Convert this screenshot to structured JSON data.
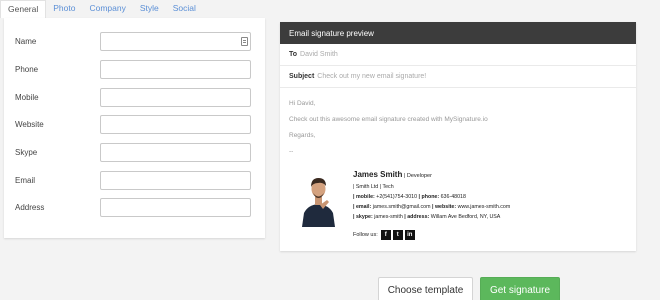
{
  "tabs": [
    {
      "label": "General",
      "active": true
    },
    {
      "label": "Photo",
      "active": false
    },
    {
      "label": "Company",
      "active": false
    },
    {
      "label": "Style",
      "active": false
    },
    {
      "label": "Social",
      "active": false
    }
  ],
  "form": {
    "fields": [
      {
        "label": "Name",
        "value": ""
      },
      {
        "label": "Phone",
        "value": ""
      },
      {
        "label": "Mobile",
        "value": ""
      },
      {
        "label": "Website",
        "value": ""
      },
      {
        "label": "Skype",
        "value": ""
      },
      {
        "label": "Email",
        "value": ""
      },
      {
        "label": "Address",
        "value": ""
      }
    ]
  },
  "preview": {
    "header": "Email signature preview",
    "to_label": "To",
    "to_value": "David Smith",
    "subject_label": "Subject",
    "subject_value": "Check out my new email signature!",
    "greeting": "Hi David,",
    "body": "Check out this awesome email signature created with MySignature.io",
    "closing": "Regards,",
    "separator": "--"
  },
  "signature": {
    "name": "James Smith",
    "title": " | Developer",
    "company_line": "| Smith Ltd | Tech",
    "mobile_label": "| mobile:",
    "mobile_value": " +2(541)754-3010",
    "phone_label": " | phone:",
    "phone_value": " 636-48018",
    "email_label": "| email:",
    "email_value": " james.smith@gmail.com",
    "website_label": " | website:",
    "website_value": " www.james-smith.com",
    "skype_label": "| skype:",
    "skype_value": " james-smith",
    "address_label": " | address:",
    "address_value": " Willam Ave Bedford, NY, USA",
    "follow_label": "Follow us:",
    "social": [
      {
        "icon": "facebook-icon",
        "glyph": "f"
      },
      {
        "icon": "twitter-icon",
        "glyph": "t"
      },
      {
        "icon": "linkedin-icon",
        "glyph": "in"
      }
    ]
  },
  "buttons": {
    "choose_template": "Choose template",
    "get_signature": "Get signature"
  },
  "colors": {
    "tab_link": "#5b8fd6",
    "preview_header_bg": "#3c3c3c",
    "get_signature_bg": "#5cb85c"
  }
}
